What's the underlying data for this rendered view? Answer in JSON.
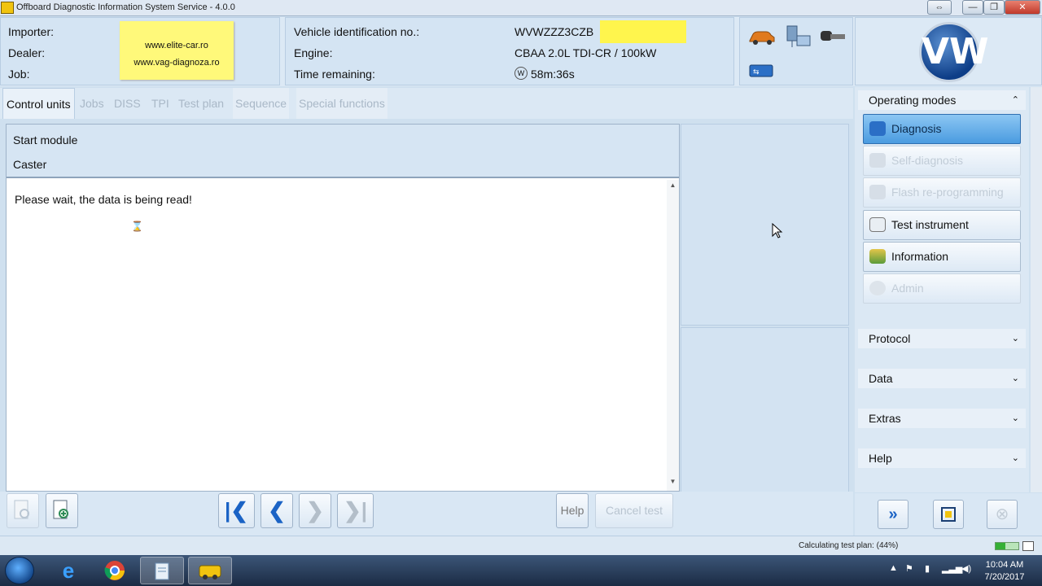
{
  "window": {
    "title": "Offboard Diagnostic Information System Service - 4.0.0",
    "controls": [
      "⇔",
      "—",
      "❐",
      "✕"
    ]
  },
  "header": {
    "importer_label": "Importer:",
    "dealer_label": "Dealer:",
    "job_label": "Job:",
    "sticky_note": [
      "www.elite-car.ro",
      "www.vag-diagnoza.ro"
    ],
    "vin_label": "Vehicle identification no.:",
    "vin_value": "WVWZZZ3CZB",
    "engine_label": "Engine:",
    "engine_value": "CBAA 2.0L TDI-CR / 100kW",
    "time_label": "Time remaining:",
    "time_value": "58m:36s",
    "brand_logo": "VW"
  },
  "tabs": [
    {
      "label": "Control units",
      "state": "active"
    },
    {
      "label": "Jobs",
      "state": "disabled"
    },
    {
      "label": "DISS",
      "state": "disabled"
    },
    {
      "label": "TPI",
      "state": "disabled"
    },
    {
      "label": "Test plan",
      "state": "disabled"
    },
    {
      "label": "Sequence",
      "state": "disabled"
    },
    {
      "label": "Special functions",
      "state": "disabled"
    }
  ],
  "main": {
    "module_title": "Start module",
    "module_subtitle": "Caster",
    "message": "Please wait, the data is being read!",
    "busy_icon": "⌛"
  },
  "toolbar": {
    "help_label": "Help",
    "cancel_label": "Cancel test",
    "nav_first": "|❮",
    "nav_prev": "❮",
    "nav_next": "❯",
    "nav_last": "❯|"
  },
  "sidebar": {
    "operating_modes_label": "Operating modes",
    "modes": [
      {
        "label": "Diagnosis",
        "state": "active",
        "icon": "stethoscope-icon"
      },
      {
        "label": "Self-diagnosis",
        "state": "disabled",
        "icon": "car-wrench-icon"
      },
      {
        "label": "Flash re-programming",
        "state": "disabled",
        "icon": "car-flash-icon"
      },
      {
        "label": "Test instrument",
        "state": "enabled",
        "icon": "gauge-icon"
      },
      {
        "label": "Information",
        "state": "enabled",
        "icon": "books-icon"
      },
      {
        "label": "Admin",
        "state": "disabled",
        "icon": "gear-icon"
      }
    ],
    "sections": [
      "Protocol",
      "Data",
      "Extras",
      "Help"
    ]
  },
  "status": {
    "text": "Calculating test plan: (44%)",
    "progress": 0.44
  },
  "taskbar": {
    "time": "10:04 AM",
    "date": "7/20/2017"
  }
}
